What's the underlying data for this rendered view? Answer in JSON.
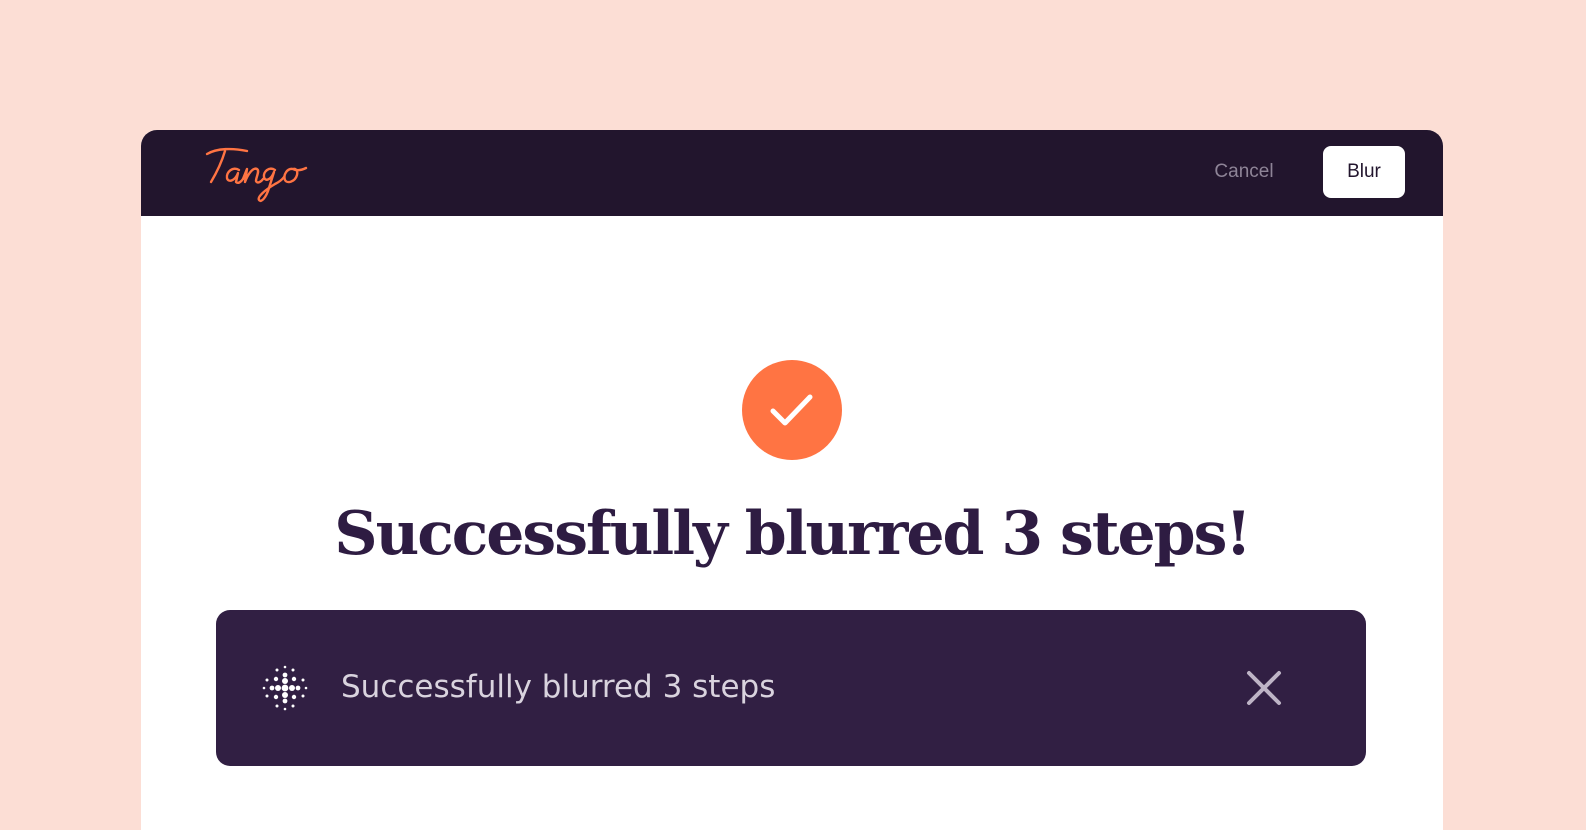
{
  "app": {
    "logo_text": "Tango",
    "brand_color": "#FF7443",
    "background_color": "#FCDED5",
    "topbar_color": "#22152D"
  },
  "topbar": {
    "cancel_label": "Cancel",
    "blur_label": "Blur"
  },
  "main": {
    "status_icon": "checkmark-icon",
    "headline": "Successfully blurred 3 steps!"
  },
  "toast": {
    "icon": "blur-dots-icon",
    "message": "Successfully blurred 3 steps",
    "close_icon": "close-icon",
    "background_color": "#311F43"
  }
}
